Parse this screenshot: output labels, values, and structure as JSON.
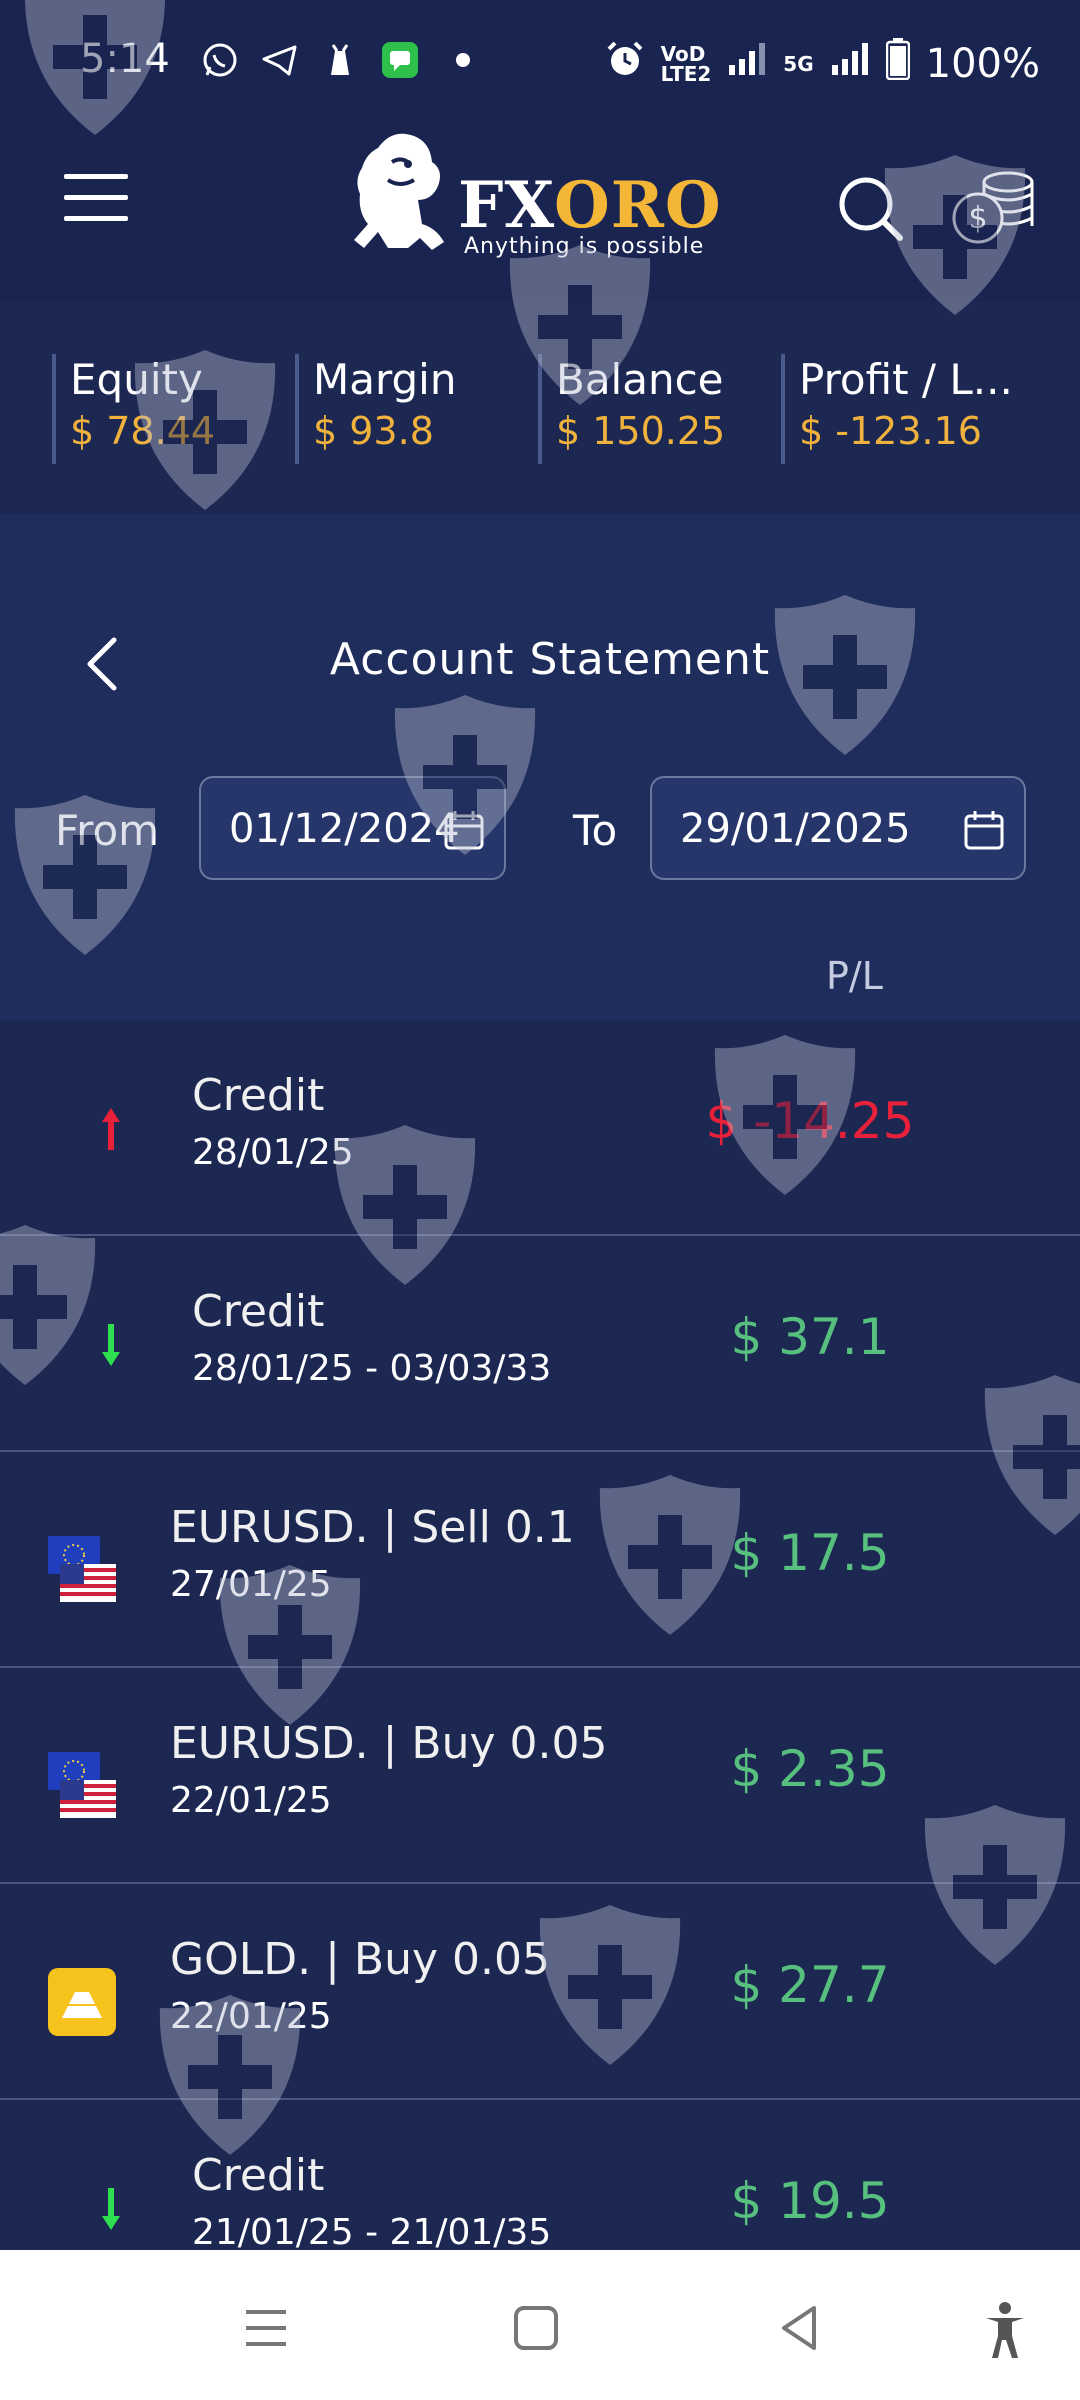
{
  "status_bar": {
    "time": "5:14",
    "network_label": "VoD\nLTE2",
    "net_5g": "5G",
    "battery": "100%"
  },
  "header": {
    "logo_fx": "FX",
    "logo_oro": "ORO",
    "tagline": "Anything is possible"
  },
  "summary": [
    {
      "label": "Equity",
      "value": "$ 78.44"
    },
    {
      "label": "Margin",
      "value": "$ 93.8"
    },
    {
      "label": "Balance",
      "value": "$ 150.25"
    },
    {
      "label": "Profit / L...",
      "value": "$ -123.16"
    }
  ],
  "statement": {
    "title": "Account Statement",
    "from_label": "From",
    "from_value": "01/12/2024",
    "to_label": "To",
    "to_value": "29/01/2025",
    "pl_header": "P/L"
  },
  "rows": [
    {
      "type": "credit",
      "direction": "up",
      "title": "Credit",
      "date": "28/01/25",
      "amount": "$ -14.25",
      "sign": "neg"
    },
    {
      "type": "credit",
      "direction": "down",
      "title": "Credit",
      "date": "28/01/25 - 03/03/33",
      "amount": "$ 37.1",
      "sign": "pos"
    },
    {
      "type": "eurusd",
      "title": "EURUSD. | Sell 0.1",
      "date": "27/01/25",
      "amount": "$ 17.5",
      "sign": "pos"
    },
    {
      "type": "eurusd",
      "title": "EURUSD. | Buy 0.05",
      "date": "22/01/25",
      "amount": "$ 2.35",
      "sign": "pos"
    },
    {
      "type": "gold",
      "title": "GOLD. | Buy 0.05",
      "date": "22/01/25",
      "amount": "$ 27.7",
      "sign": "pos"
    },
    {
      "type": "credit",
      "direction": "down",
      "title": "Credit",
      "date": "21/01/25 - 21/01/35",
      "amount": "$ 19.5",
      "sign": "pos"
    }
  ],
  "colors": {
    "accent_gold": "#f0b23d",
    "positive": "#57c07f",
    "negative": "#e8203a",
    "background": "#1b2650"
  }
}
